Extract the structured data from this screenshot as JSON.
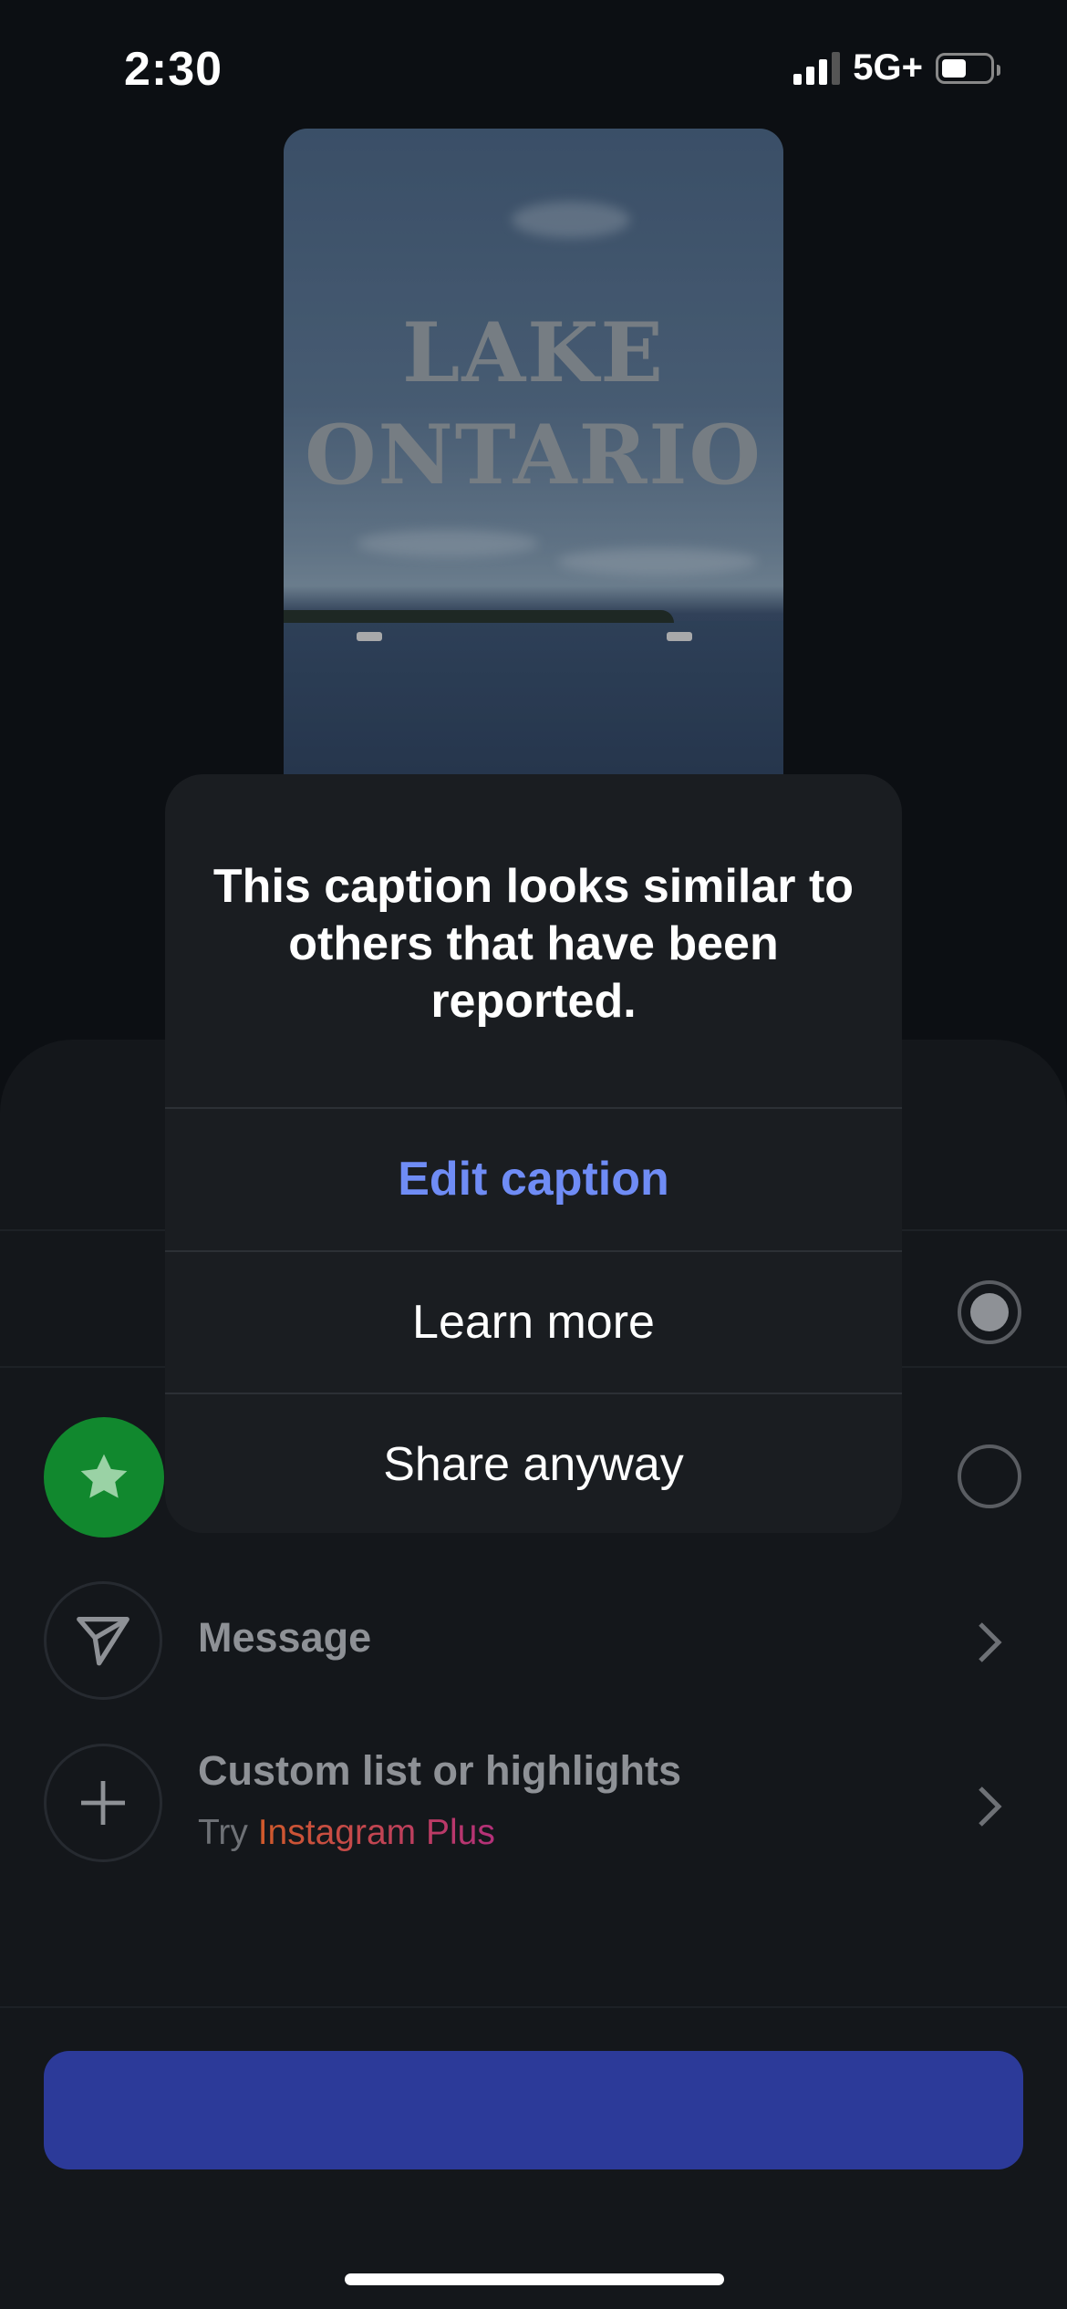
{
  "status_bar": {
    "time": "2:30",
    "network": "5G+",
    "icons": [
      "cellular-signal-icon",
      "battery-icon"
    ]
  },
  "preview": {
    "overlay_text": "LAKE\nONTARIO"
  },
  "dialog": {
    "title": "This caption looks similar to others that have been reported.",
    "actions": [
      {
        "label": "Edit caption",
        "style": "primary",
        "color": "#6f8cf5"
      },
      {
        "label": "Learn more",
        "style": "default"
      },
      {
        "label": "Share anyway",
        "style": "default"
      }
    ]
  },
  "sheet": {
    "audience_options": [
      {
        "icon": "star-icon",
        "selected": false,
        "badge_color": "#11882e"
      }
    ],
    "selected_radio": "first",
    "rows": [
      {
        "icon": "send-icon",
        "label": "Message",
        "action_icon": "chevron-right-icon"
      },
      {
        "icon": "plus-icon",
        "label": "Custom list or highlights",
        "sub_prefix": "Try",
        "sub_link": "Instagram Plus",
        "action_icon": "chevron-right-icon"
      }
    ],
    "share_button_color": "#2c3a99"
  },
  "colors": {
    "background": "#0c0f13",
    "dialog_background": "#1a1d21",
    "accent": "#6f8cf5"
  }
}
